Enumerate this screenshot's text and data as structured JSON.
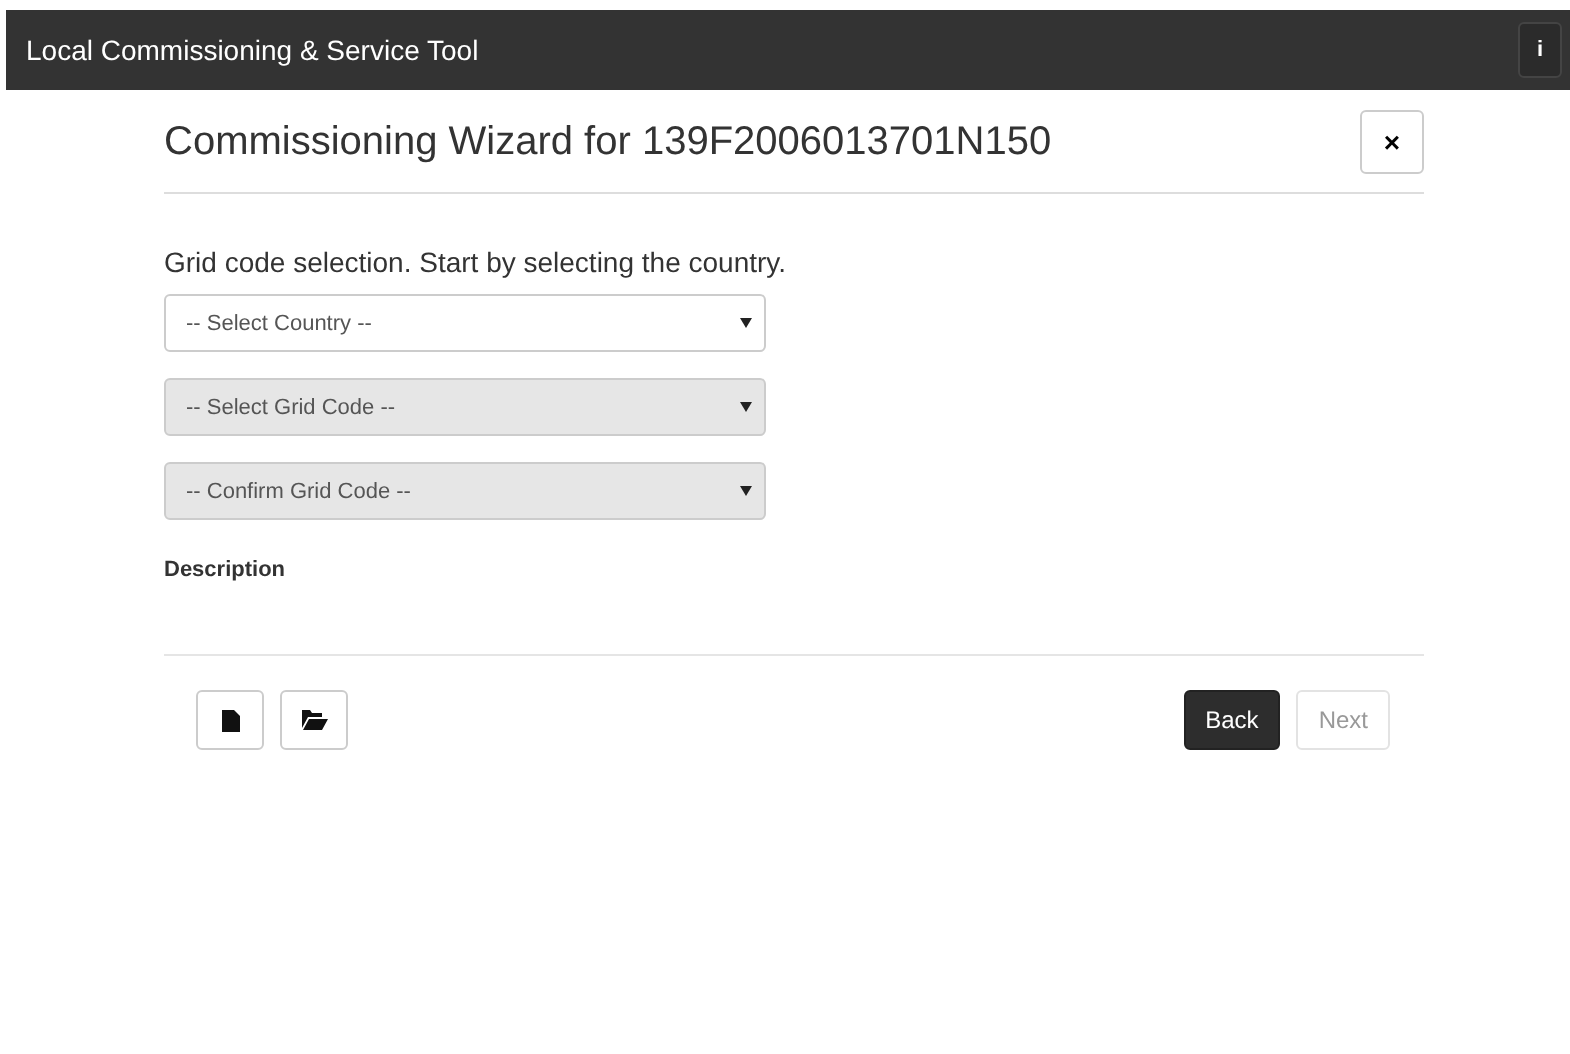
{
  "app_bar": {
    "title": "Local Commissioning & Service Tool",
    "info_button": "i"
  },
  "dialog": {
    "title": "Commissioning Wizard for 139F2006013701N150",
    "close_button": "×",
    "instruction": "Grid code selection. Start by selecting the country.",
    "selects": [
      {
        "value": "-- Select Country --",
        "disabled": false
      },
      {
        "value": "-- Select Grid Code --",
        "disabled": true
      },
      {
        "value": "-- Confirm Grid Code --",
        "disabled": true
      }
    ],
    "description_label": "Description",
    "buttons": [
      {
        "label": "Back",
        "kind": "primary",
        "disabled": false
      },
      {
        "label": "Next",
        "kind": "default",
        "disabled": true
      }
    ]
  }
}
